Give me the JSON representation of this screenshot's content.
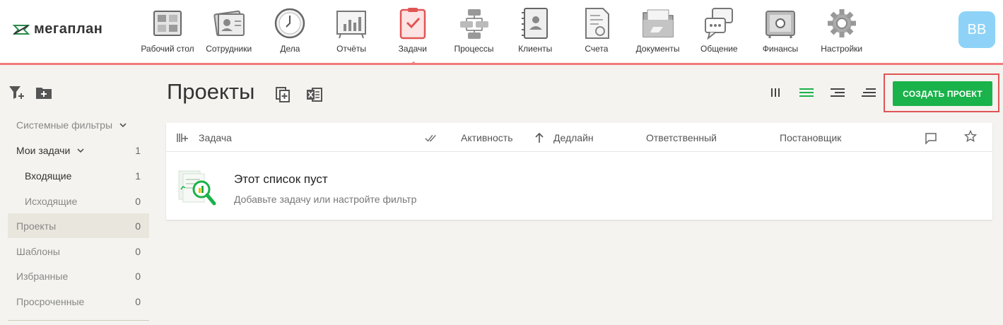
{
  "app": {
    "logo_text": "мегаплан",
    "avatar_initials": "ВВ",
    "accent_color": "#f07b7b",
    "brand_green": "#1ab24a"
  },
  "nav": [
    {
      "label": "Рабочий стол",
      "icon": "desktop-icon"
    },
    {
      "label": "Сотрудники",
      "icon": "employees-icon"
    },
    {
      "label": "Дела",
      "icon": "clock-icon"
    },
    {
      "label": "Отчёты",
      "icon": "reports-icon"
    },
    {
      "label": "Задачи",
      "icon": "tasks-icon",
      "active": true
    },
    {
      "label": "Процессы",
      "icon": "processes-icon"
    },
    {
      "label": "Клиенты",
      "icon": "clients-icon"
    },
    {
      "label": "Счета",
      "icon": "invoices-icon"
    },
    {
      "label": "Документы",
      "icon": "documents-icon"
    },
    {
      "label": "Общение",
      "icon": "chat-icon"
    },
    {
      "label": "Финансы",
      "icon": "safe-icon"
    },
    {
      "label": "Настройки",
      "icon": "settings-gear-icon"
    }
  ],
  "sidebar": {
    "items": [
      {
        "label": "Системные фильтры",
        "count": "",
        "style": "muted",
        "chevron": true
      },
      {
        "label": "Мои задачи",
        "count": "1",
        "style": "",
        "chevron": true
      },
      {
        "label": "Входящие",
        "count": "1",
        "style": "sub"
      },
      {
        "label": "Исходящие",
        "count": "0",
        "style": "sub muted"
      },
      {
        "label": "Проекты",
        "count": "0",
        "style": "muted active"
      },
      {
        "label": "Шаблоны",
        "count": "0",
        "style": "muted"
      },
      {
        "label": "Избранные",
        "count": "0",
        "style": "muted"
      },
      {
        "label": "Просроченные",
        "count": "0",
        "style": "muted"
      }
    ]
  },
  "main": {
    "title": "Проекты",
    "create_button": "СОЗДАТЬ ПРОЕКТ",
    "columns": {
      "task": "Задача",
      "activity": "Активность",
      "deadline": "Дедлайн",
      "responsible": "Ответственный",
      "author": "Постановщик"
    },
    "empty": {
      "title": "Этот список пуст",
      "subtitle": "Добавьте задачу или настройте фильтр"
    }
  }
}
